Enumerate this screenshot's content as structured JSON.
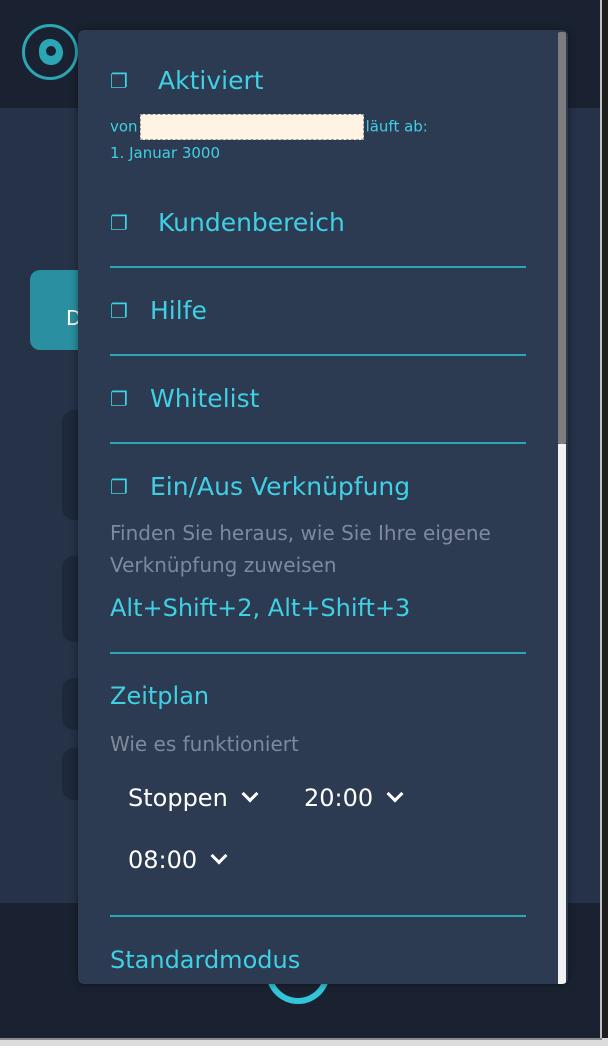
{
  "menu": {
    "activated": {
      "label": "Aktiviert",
      "prefix": "von",
      "suffix": "läuft ab:",
      "expiry": "1. Januar 3000"
    },
    "customer_area": {
      "label": "Kundenbereich"
    },
    "help": {
      "label": "Hilfe"
    },
    "whitelist": {
      "label": "Whitelist"
    },
    "toggle_shortcut": {
      "label": "Ein/Aus Verknüpfung",
      "help_text": "Finden Sie heraus, wie Sie Ihre eigene Verknüpfung zuweisen",
      "shortcuts": "Alt+Shift+2, Alt+Shift+3"
    },
    "schedule": {
      "label": "Zeitplan",
      "how_it_works": "Wie es funktioniert",
      "mode_value": "Stoppen",
      "start_time": "20:00",
      "end_time": "08:00"
    },
    "default_mode": {
      "label": "Standardmodus"
    },
    "external_icon": "❐"
  },
  "background": {
    "tab_letter": "D"
  },
  "colors": {
    "accent": "#3fd0e4",
    "panel": "#2c3a52",
    "divider": "#2aa6b4",
    "muted": "#7e8a9b"
  },
  "icons": [
    "eye-logo-icon",
    "external-link-icon",
    "chevron-down-icon",
    "power-icon"
  ]
}
